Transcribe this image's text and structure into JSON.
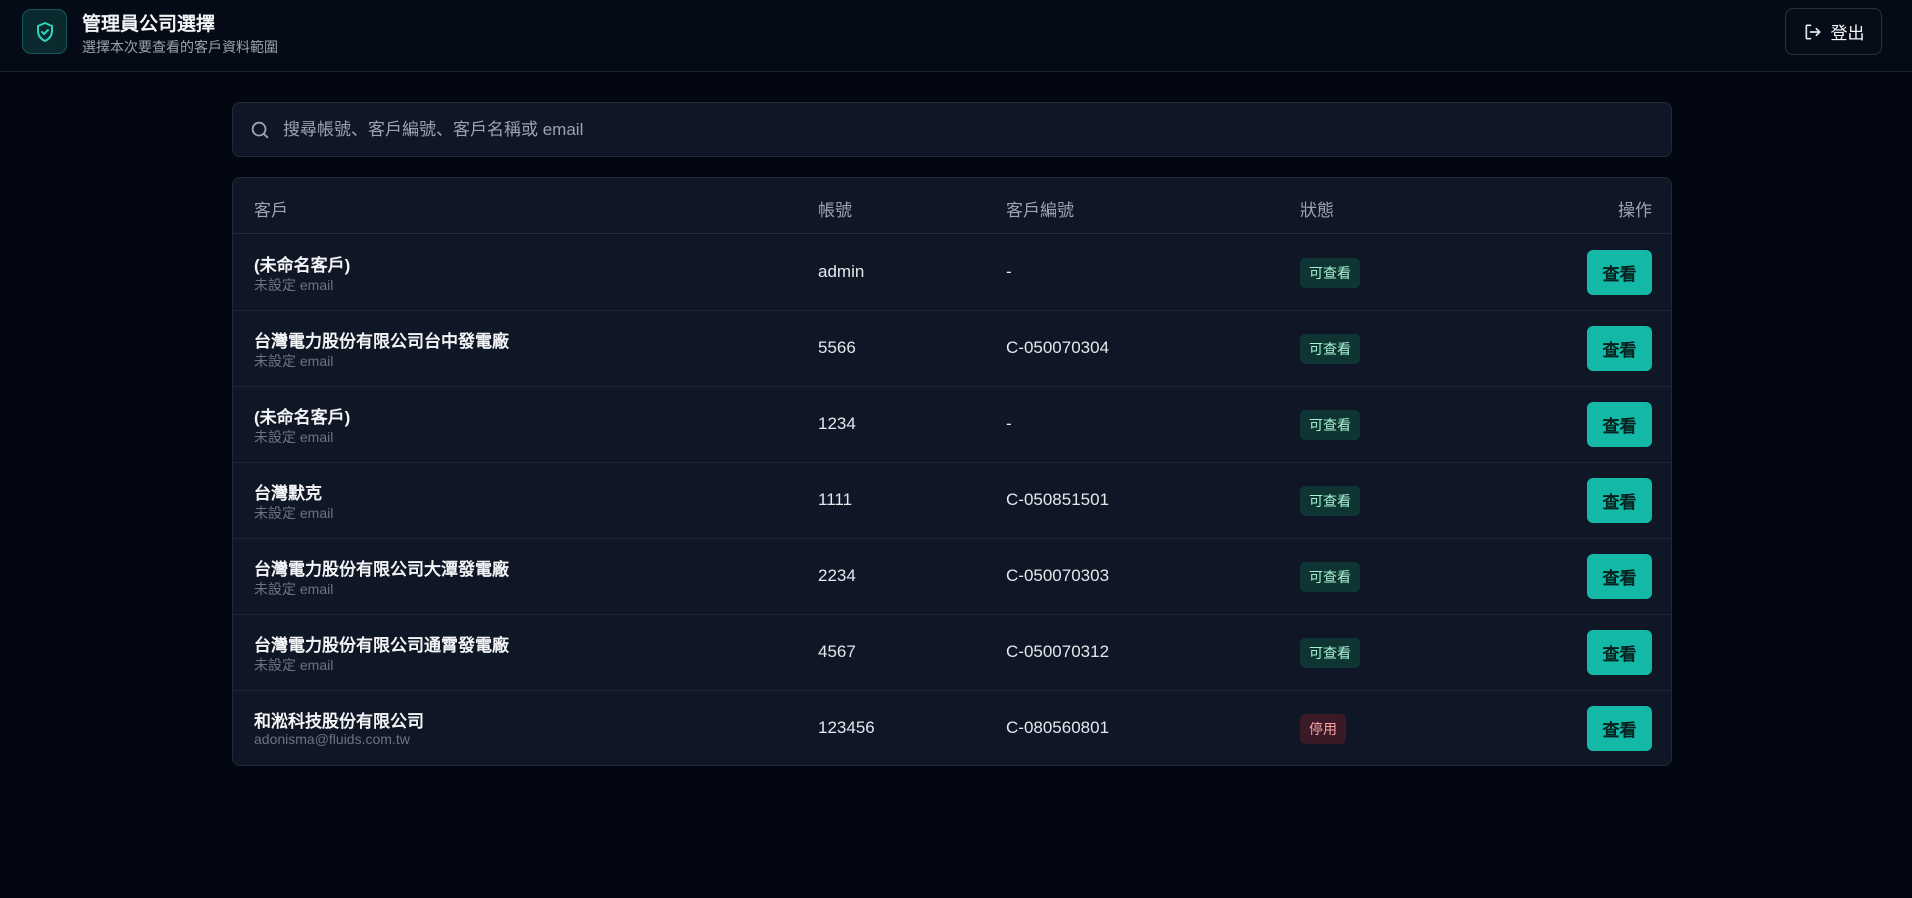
{
  "header": {
    "title": "管理員公司選擇",
    "subtitle": "選擇本次要查看的客戶資料範圍",
    "logout_label": "登出"
  },
  "search": {
    "placeholder": "搜尋帳號、客戶編號、客戶名稱或 email",
    "value": ""
  },
  "table": {
    "columns": {
      "customer": "客戶",
      "account": "帳號",
      "code": "客戶編號",
      "status": "狀態",
      "action": "操作"
    },
    "rows": [
      {
        "name": "(未命名客戶)",
        "email": "未設定 email",
        "account": "admin",
        "code": "-",
        "status": "可查看",
        "status_type": "ok",
        "action": "查看"
      },
      {
        "name": "台灣電力股份有限公司台中發電廠",
        "email": "未設定 email",
        "account": "5566",
        "code": "C-050070304",
        "status": "可查看",
        "status_type": "ok",
        "action": "查看"
      },
      {
        "name": "(未命名客戶)",
        "email": "未設定 email",
        "account": "1234",
        "code": "-",
        "status": "可查看",
        "status_type": "ok",
        "action": "查看"
      },
      {
        "name": "台灣默克",
        "email": "未設定 email",
        "account": "1111",
        "code": "C-050851501",
        "status": "可查看",
        "status_type": "ok",
        "action": "查看"
      },
      {
        "name": "台灣電力股份有限公司大潭發電廠",
        "email": "未設定 email",
        "account": "2234",
        "code": "C-050070303",
        "status": "可查看",
        "status_type": "ok",
        "action": "查看"
      },
      {
        "name": "台灣電力股份有限公司通霄發電廠",
        "email": "未設定 email",
        "account": "4567",
        "code": "C-050070312",
        "status": "可查看",
        "status_type": "ok",
        "action": "查看"
      },
      {
        "name": "和淞科技股份有限公司",
        "email": "adonisma@fluids.com.tw",
        "account": "123456",
        "code": "C-080560801",
        "status": "停用",
        "status_type": "off",
        "action": "查看"
      }
    ]
  },
  "colors": {
    "background": "#030712",
    "accent": "#14b8a6",
    "badge_ok": "#0e3434",
    "badge_off": "#3a1a26"
  },
  "icons": {
    "brand": "shield-check-icon",
    "logout": "logout-icon",
    "search": "search-icon"
  }
}
